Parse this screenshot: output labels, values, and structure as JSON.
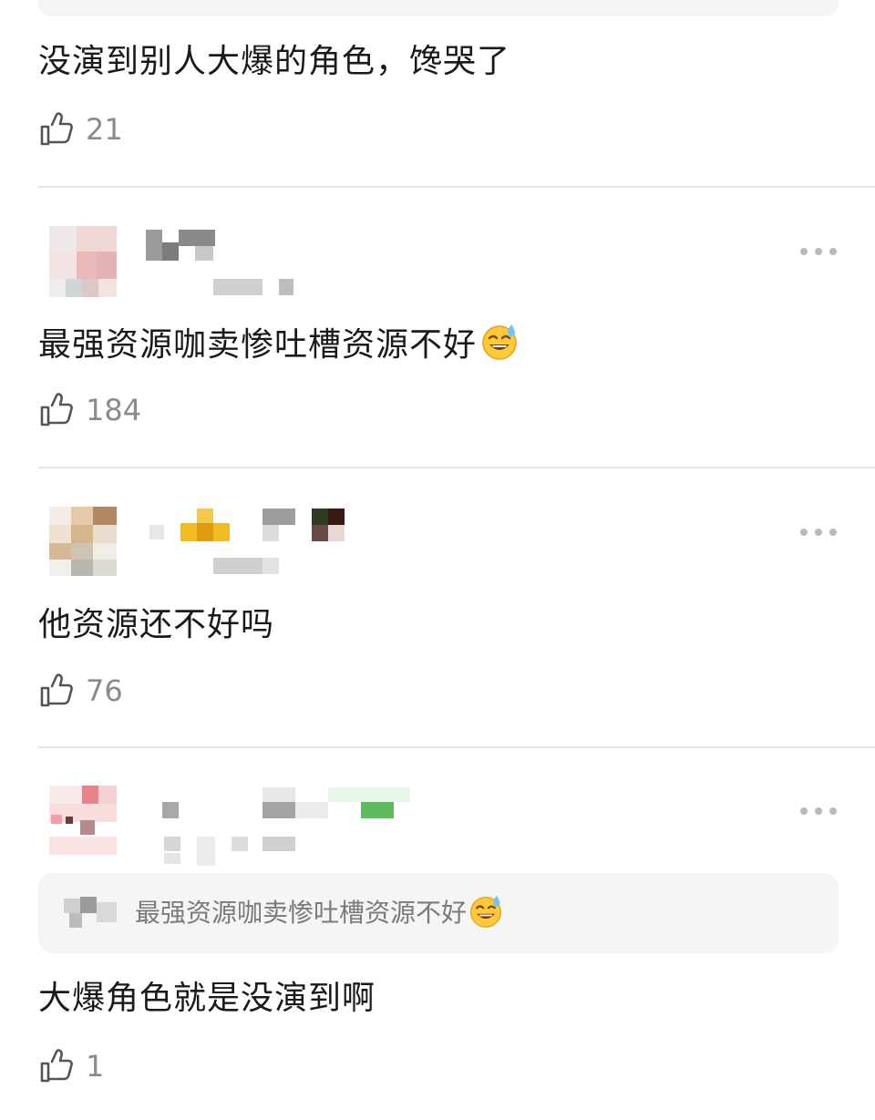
{
  "comments": [
    {
      "text": "没演到别人大爆的角色，馋哭了",
      "likes": "21"
    },
    {
      "text": "最强资源咖卖惨吐槽资源不好",
      "emoji": "sweat-smile-emoji",
      "likes": "184"
    },
    {
      "text": "他资源还不好吗",
      "likes": "76"
    },
    {
      "quote": {
        "text": "最强资源咖卖惨吐槽资源不好",
        "emoji": "sweat-smile-emoji"
      },
      "text": "大爆角色就是没演到啊",
      "likes": "1"
    }
  ],
  "icons": {
    "like": "thumbs-up-icon",
    "more": "more-dots-icon"
  },
  "colors": {
    "text": "#1a1a1a",
    "count": "#8a8a8a",
    "quote_bg": "#f5f5f5",
    "quote_text": "#7a7a7a",
    "divider": "#e6e6e6",
    "dots": "#b9b9b9"
  }
}
